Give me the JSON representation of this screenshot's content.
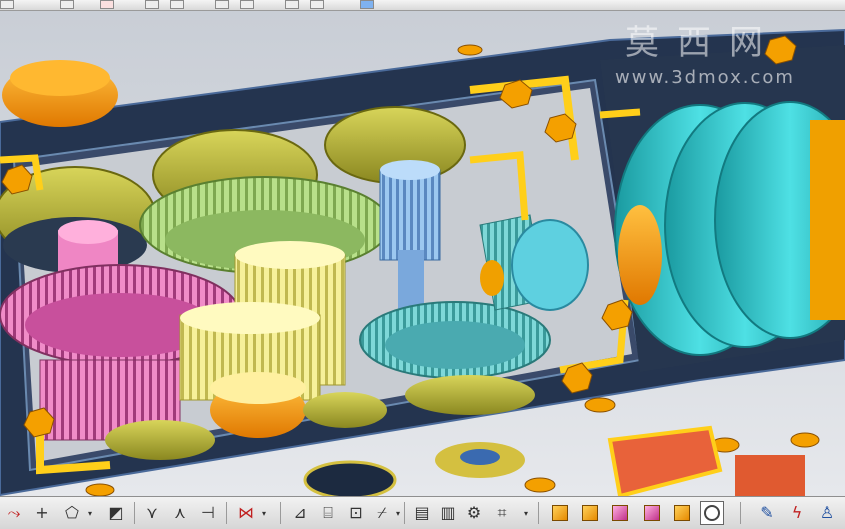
{
  "watermark": {
    "title": "莫西网",
    "url": "www.3dmox.com"
  },
  "toolbars": {
    "top": {
      "icons": [
        "sketch-icon",
        "grid-icon",
        "snap-icon",
        "line-icon",
        "arc-icon",
        "rotate-icon",
        "spin-icon",
        "point-icon",
        "arrow-icon",
        "cube-icon"
      ]
    },
    "bottom": {
      "icons": [
        "curve-icon",
        "cross-icon",
        "shape-icon",
        "surface-icon",
        "trim-icon",
        "bend-icon",
        "split-icon",
        "align-icon",
        "constraint-icon",
        "offset-icon",
        "frame-icon",
        "mirror-icon",
        "pattern-icon",
        "section-icon",
        "assembly-icon",
        "measure-icon",
        "explode-icon",
        "view-iso-icon",
        "view-front-icon",
        "view-top-icon",
        "view-right-icon",
        "view-back-icon",
        "clock-icon",
        "pen-icon",
        "bolt-icon",
        "person-icon"
      ]
    }
  },
  "colors": {
    "housing": "#2a3a5a",
    "housing_edge": "#4a6a9a",
    "gear_olive": "#b8b53a",
    "gear_green": "#b8e08a",
    "gear_pink": "#e070b8",
    "gear_yellow": "#f2ec8a",
    "gear_blue": "#8ab8e8",
    "gear_cyan": "#6ec8c8",
    "bracket": "#ffcf1a",
    "bolt": "#f4a000",
    "disc_cyan": "#2ec4c8",
    "copper": "#e05a30"
  }
}
